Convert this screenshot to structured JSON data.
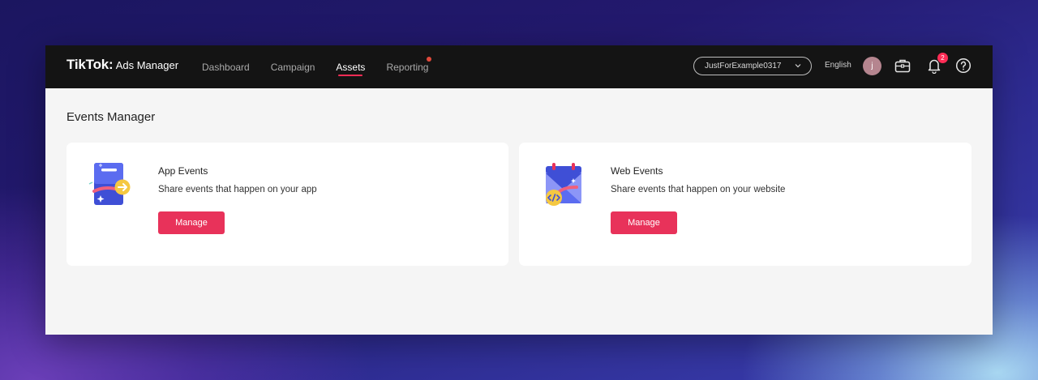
{
  "brand": {
    "name": "TikTok",
    "separator": ":",
    "product": "Ads Manager"
  },
  "nav": {
    "items": [
      {
        "label": "Dashboard"
      },
      {
        "label": "Campaign"
      },
      {
        "label": "Assets",
        "active": true
      },
      {
        "label": "Reporting",
        "has_dot": true
      }
    ]
  },
  "header": {
    "account_name": "JustForExample0317",
    "language": "English",
    "avatar_initial": "j",
    "notifications_count": "2",
    "icons": [
      "chevron-down-icon",
      "briefcase-icon",
      "bell-icon",
      "help-icon"
    ]
  },
  "main": {
    "title": "Events Manager",
    "cards": [
      {
        "title": "App Events",
        "description": "Share events that happen on your app",
        "button_label": "Manage",
        "icon": "app-events-icon"
      },
      {
        "title": "Web Events",
        "description": "Share events that happen on your website",
        "button_label": "Manage",
        "icon": "web-events-icon"
      }
    ]
  },
  "colors": {
    "accent": "#fe2c55",
    "button": "#e8325a",
    "topbar": "#141414",
    "background": "#f5f5f5"
  }
}
